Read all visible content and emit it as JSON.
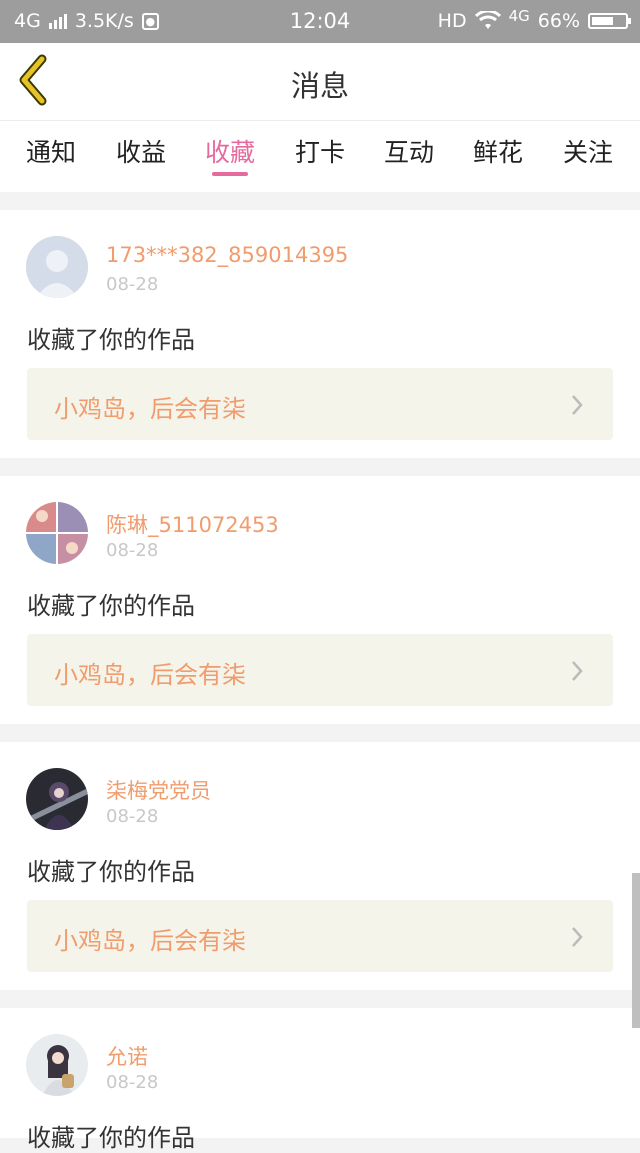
{
  "status_bar": {
    "network": "4G",
    "speed": "3.5K/s",
    "time": "12:04",
    "hd": "HD",
    "network2": "4G",
    "battery": "66%",
    "battery_level": 0.66
  },
  "header": {
    "title": "消息",
    "back_icon": "back-chevron-icon"
  },
  "tabs": [
    {
      "label": "通知",
      "active": false
    },
    {
      "label": "收益",
      "active": false
    },
    {
      "label": "收藏",
      "active": true
    },
    {
      "label": "打卡",
      "active": false
    },
    {
      "label": "互动",
      "active": false
    },
    {
      "label": "鲜花",
      "active": false
    },
    {
      "label": "关注",
      "active": false
    }
  ],
  "messages": [
    {
      "username": "173***382_859014395",
      "date": "08-28",
      "action": "收藏了你的作品",
      "work": "小鸡岛，后会有柒",
      "avatar": "default-avatar"
    },
    {
      "username": "陈琳_511072453",
      "date": "08-28",
      "action": "收藏了你的作品",
      "work": "小鸡岛，后会有柒",
      "avatar": "collage-avatar"
    },
    {
      "username": "柒梅党党员",
      "date": "08-28",
      "action": "收藏了你的作品",
      "work": "小鸡岛，后会有柒",
      "avatar": "anime-avatar"
    },
    {
      "username": "允诺",
      "date": "08-28",
      "action": "收藏了你的作品",
      "work": "",
      "avatar": "girl-avatar"
    }
  ],
  "colors": {
    "accent": "#e56a9e",
    "username": "#f09c6d",
    "work_bg": "#f5f4ea",
    "back_icon": "#e8c229"
  }
}
